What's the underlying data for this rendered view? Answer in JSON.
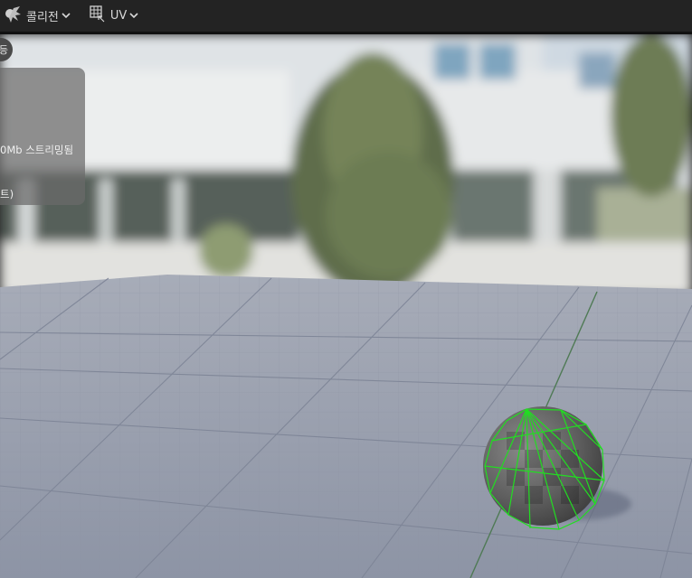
{
  "toolbar": {
    "collision_label": "콜리전",
    "uv_label": "UV"
  },
  "overlay": {
    "badge_text": "등",
    "stat_line": "0Mb 스트리밍됨",
    "stat_line2": "트)"
  },
  "colors": {
    "toolbar_bg": "#232323",
    "grid_floor": "#9aa0b0",
    "collision_wire": "#22dd22",
    "sky": "#dfe6ea"
  },
  "icons": [
    "collision-icon",
    "uv-grid-icon",
    "chevron-down-icon"
  ]
}
